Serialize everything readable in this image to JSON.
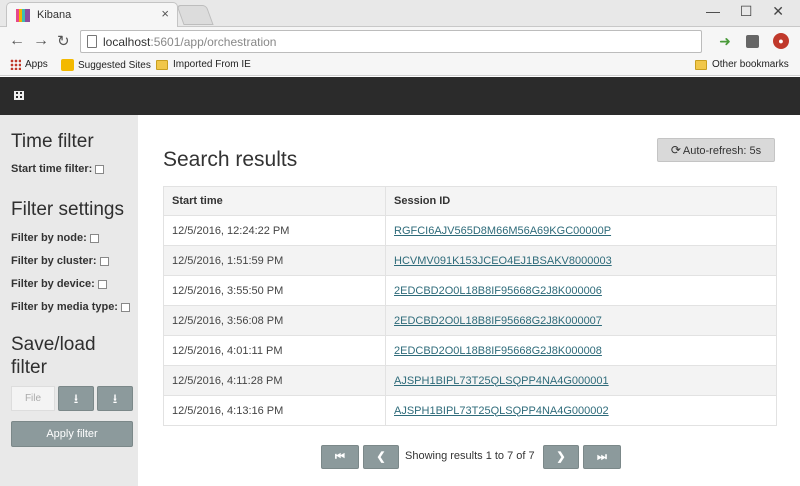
{
  "browser": {
    "tab_title": "Kibana",
    "tab_close": "×",
    "window_controls": "— ☐ ✕",
    "url_host": "localhost",
    "url_path": ":5601/app/orchestration",
    "bookmarks": {
      "apps": "Apps",
      "suggested": "Suggested Sites",
      "imported": "Imported From IE",
      "other": "Other bookmarks"
    }
  },
  "sidebar": {
    "time_filter_title": "Time filter",
    "start_time_label": "Start time filter:",
    "filter_settings_title": "Filter settings",
    "filters": [
      "Filter by node:",
      "Filter by cluster:",
      "Filter by device:",
      "Filter by media type:"
    ],
    "save_load_title_1": "Save/load",
    "save_load_title_2": "filter",
    "file_placeholder": "File",
    "apply_label": "Apply filter"
  },
  "main": {
    "title": "Search results",
    "auto_refresh_label": "Auto-refresh: 5s",
    "columns": [
      "Start time",
      "Session ID"
    ],
    "rows": [
      {
        "start": "12/5/2016, 12:24:22 PM",
        "session": "RGFCI6AJV565D8M66M56A69KGC00000P"
      },
      {
        "start": "12/5/2016, 1:51:59 PM",
        "session": "HCVMV091K153JCEO4EJ1BSAKV8000003"
      },
      {
        "start": "12/5/2016, 3:55:50 PM",
        "session": "2EDCBD2O0L18B8IF95668G2J8K000006"
      },
      {
        "start": "12/5/2016, 3:56:08 PM",
        "session": "2EDCBD2O0L18B8IF95668G2J8K000007"
      },
      {
        "start": "12/5/2016, 4:01:11 PM",
        "session": "2EDCBD2O0L18B8IF95668G2J8K000008"
      },
      {
        "start": "12/5/2016, 4:11:28 PM",
        "session": "AJSPH1BIPL73T25QLSQPP4NA4G000001"
      },
      {
        "start": "12/5/2016, 4:13:16 PM",
        "session": "AJSPH1BIPL73T25QLSQPP4NA4G000002"
      }
    ],
    "pager_text": "Showing results 1 to 7 of 7"
  },
  "colors": {
    "header_bg": "#2b2b2b",
    "sidebar_bg": "#e9e9e9",
    "button_bg": "#8c9a9c",
    "link": "#2e6b7a"
  }
}
